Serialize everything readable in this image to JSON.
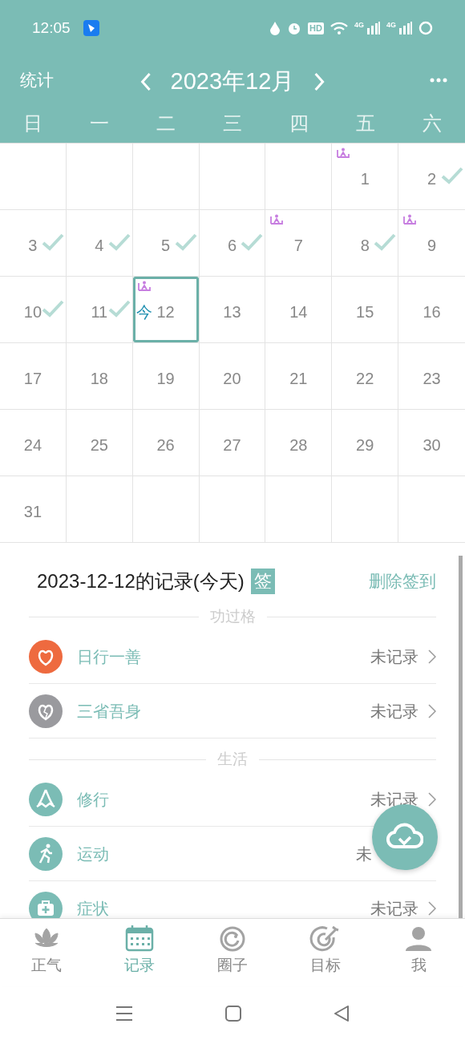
{
  "status_bar": {
    "time": "12:05",
    "hd": "HD",
    "net": [
      "4G",
      "4G"
    ]
  },
  "header": {
    "left": "统计",
    "title": "2023年12月"
  },
  "weekdays": [
    "日",
    "一",
    "二",
    "三",
    "四",
    "五",
    "六"
  ],
  "calendar": {
    "weeks": [
      [
        {
          "kind": "blank"
        },
        {
          "kind": "blank"
        },
        {
          "kind": "blank"
        },
        {
          "kind": "blank"
        },
        {
          "kind": "blank"
        },
        {
          "kind": "day",
          "day": "1",
          "checked": false,
          "meditated": true,
          "today": false
        },
        {
          "kind": "day",
          "day": "2",
          "checked": true,
          "meditated": false,
          "today": false
        }
      ],
      [
        {
          "kind": "day",
          "day": "3",
          "checked": true,
          "meditated": false,
          "today": false
        },
        {
          "kind": "day",
          "day": "4",
          "checked": true,
          "meditated": false,
          "today": false
        },
        {
          "kind": "day",
          "day": "5",
          "checked": true,
          "meditated": false,
          "today": false
        },
        {
          "kind": "day",
          "day": "6",
          "checked": true,
          "meditated": false,
          "today": false
        },
        {
          "kind": "day",
          "day": "7",
          "checked": false,
          "meditated": true,
          "today": false
        },
        {
          "kind": "day",
          "day": "8",
          "checked": true,
          "meditated": false,
          "today": false
        },
        {
          "kind": "day",
          "day": "9",
          "checked": false,
          "meditated": true,
          "today": false
        }
      ],
      [
        {
          "kind": "day",
          "day": "10",
          "checked": true,
          "meditated": false,
          "today": false
        },
        {
          "kind": "day",
          "day": "11",
          "checked": true,
          "meditated": false,
          "today": false
        },
        {
          "kind": "day",
          "day": "12",
          "checked": false,
          "meditated": true,
          "today": true,
          "today_mark": "今"
        },
        {
          "kind": "day",
          "day": "13",
          "checked": false,
          "meditated": false,
          "today": false
        },
        {
          "kind": "day",
          "day": "14",
          "checked": false,
          "meditated": false,
          "today": false
        },
        {
          "kind": "day",
          "day": "15",
          "checked": false,
          "meditated": false,
          "today": false
        },
        {
          "kind": "day",
          "day": "16",
          "checked": false,
          "meditated": false,
          "today": false
        }
      ],
      [
        {
          "kind": "day",
          "day": "17",
          "checked": false,
          "meditated": false,
          "today": false
        },
        {
          "kind": "day",
          "day": "18",
          "checked": false,
          "meditated": false,
          "today": false
        },
        {
          "kind": "day",
          "day": "19",
          "checked": false,
          "meditated": false,
          "today": false
        },
        {
          "kind": "day",
          "day": "20",
          "checked": false,
          "meditated": false,
          "today": false
        },
        {
          "kind": "day",
          "day": "21",
          "checked": false,
          "meditated": false,
          "today": false
        },
        {
          "kind": "day",
          "day": "22",
          "checked": false,
          "meditated": false,
          "today": false
        },
        {
          "kind": "day",
          "day": "23",
          "checked": false,
          "meditated": false,
          "today": false
        }
      ],
      [
        {
          "kind": "day",
          "day": "24",
          "checked": false,
          "meditated": false,
          "today": false
        },
        {
          "kind": "day",
          "day": "25",
          "checked": false,
          "meditated": false,
          "today": false
        },
        {
          "kind": "day",
          "day": "26",
          "checked": false,
          "meditated": false,
          "today": false
        },
        {
          "kind": "day",
          "day": "27",
          "checked": false,
          "meditated": false,
          "today": false
        },
        {
          "kind": "day",
          "day": "28",
          "checked": false,
          "meditated": false,
          "today": false
        },
        {
          "kind": "day",
          "day": "29",
          "checked": false,
          "meditated": false,
          "today": false
        },
        {
          "kind": "day",
          "day": "30",
          "checked": false,
          "meditated": false,
          "today": false
        }
      ],
      [
        {
          "kind": "day",
          "day": "31",
          "checked": false,
          "meditated": false,
          "today": false
        },
        {
          "kind": "blank"
        },
        {
          "kind": "blank"
        },
        {
          "kind": "blank"
        },
        {
          "kind": "blank"
        },
        {
          "kind": "blank"
        },
        {
          "kind": "blank"
        }
      ]
    ]
  },
  "record": {
    "title": "2023-12-12的记录(今天)",
    "badge": "签",
    "action": "删除签到",
    "sections": [
      {
        "title": "功过格",
        "items": [
          {
            "kind": "heart",
            "label": "日行一善",
            "status": "未记录",
            "chevron": true
          },
          {
            "kind": "broken-heart",
            "label": "三省吾身",
            "status": "未记录",
            "chevron": true
          }
        ]
      },
      {
        "title": "生活",
        "items": [
          {
            "kind": "hands",
            "label": "修行",
            "status": "未记录",
            "chevron": true
          },
          {
            "kind": "runner",
            "label": "运动",
            "status": "未",
            "chevron": false
          },
          {
            "kind": "medkit",
            "label": "症状",
            "status": "未记录",
            "chevron": true
          }
        ]
      }
    ]
  },
  "tabs": [
    {
      "kind": "lotus",
      "label": "正气",
      "selected": false
    },
    {
      "kind": "calendar",
      "label": "记录",
      "selected": true
    },
    {
      "kind": "ring",
      "label": "圈子",
      "selected": false
    },
    {
      "kind": "target",
      "label": "目标",
      "selected": false
    },
    {
      "kind": "person",
      "label": "我",
      "selected": false
    }
  ]
}
